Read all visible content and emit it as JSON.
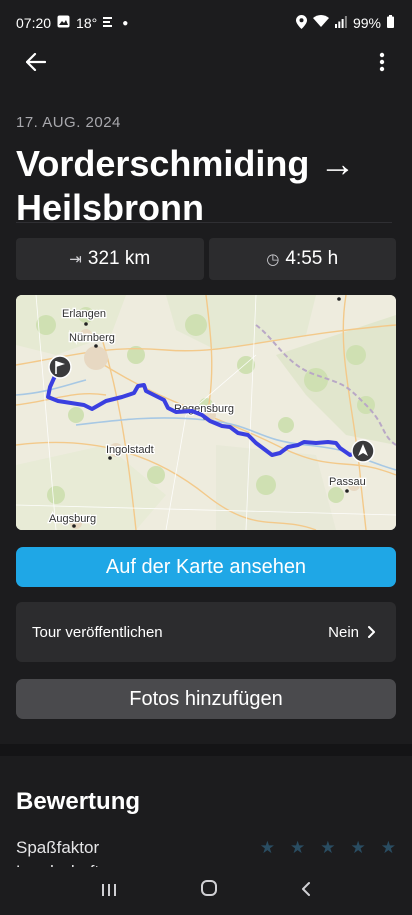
{
  "status_bar": {
    "time": "07:20",
    "notification_temp": "18°",
    "battery": "99%"
  },
  "header": {
    "back_icon": "arrow-left-icon",
    "more_icon": "more-vertical-icon"
  },
  "tour": {
    "date": "17. AUG. 2024",
    "title": "Vorderschmiding → Heilsbronn",
    "distance": "321 km",
    "duration": "4:55 h"
  },
  "map": {
    "labels": {
      "erlangen": "Erlangen",
      "nuernberg": "Nürnberg",
      "regensburg": "Regensburg",
      "ingolstadt": "Ingolstadt",
      "passau": "Passau",
      "augsburg": "Augsburg"
    },
    "route_color": "#3a3fe0"
  },
  "actions": {
    "view_on_map": "Auf der Karte ansehen",
    "publish_label": "Tour veröffentlichen",
    "publish_value": "Nein",
    "add_photos": "Fotos hinzufügen"
  },
  "rating": {
    "title": "Bewertung",
    "fun_label": "Spaßfaktor",
    "fun_stars": 0,
    "next_label": "Landschaft"
  },
  "colors": {
    "accent": "#1fa7e6",
    "background": "#1c1c1e",
    "card": "#2c2c2e"
  }
}
